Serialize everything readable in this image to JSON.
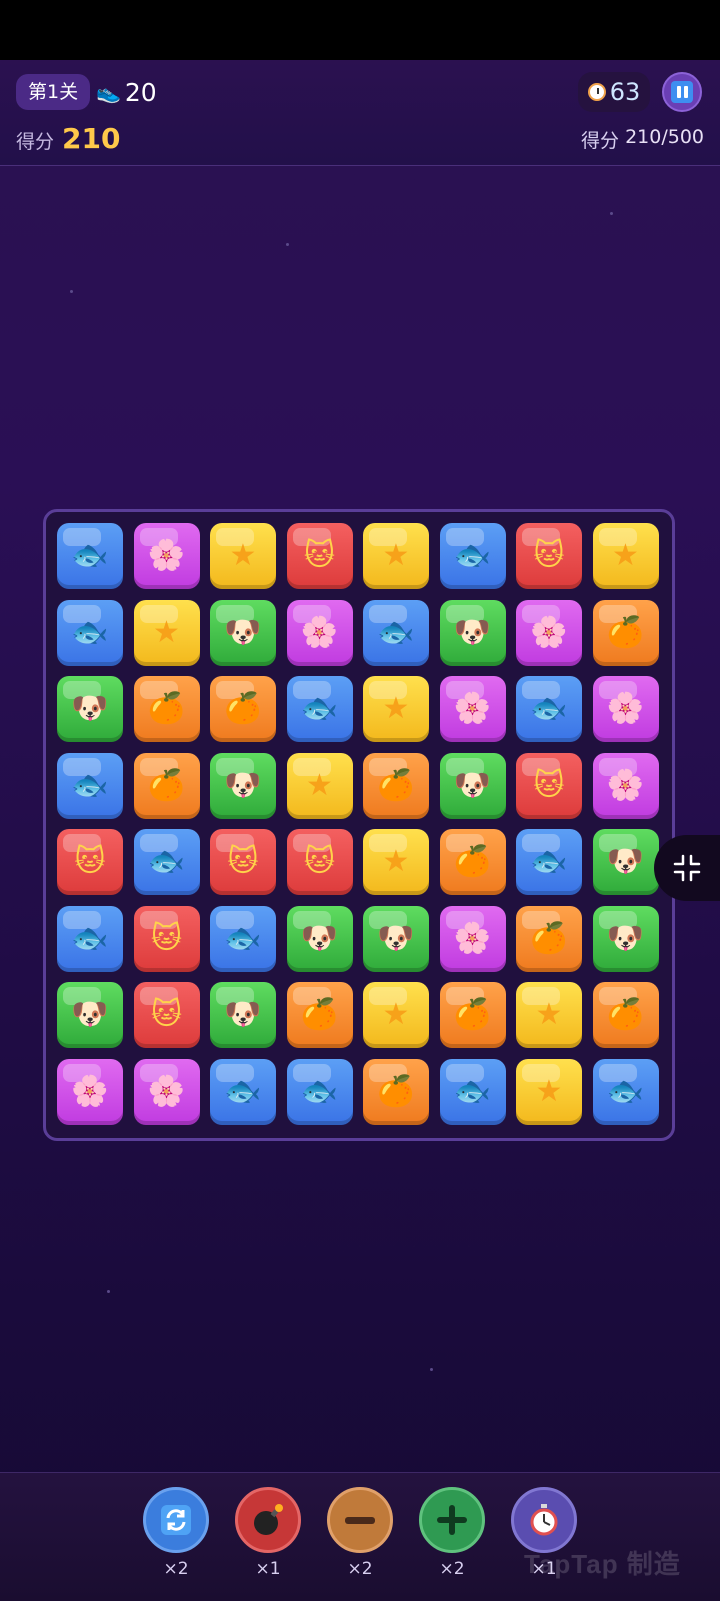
{
  "header": {
    "level_label": "第1关",
    "moves_icon": "sneaker-icon",
    "moves_value": "20",
    "timer_icon": "stopwatch-icon",
    "timer_value": "63",
    "pause_icon": "pause-icon",
    "score_label": "得分",
    "score_value": "210",
    "target_label": "得分",
    "target_value": "210/500"
  },
  "board": {
    "rows": 8,
    "cols": 8,
    "tiles": [
      [
        "fish",
        "flower",
        "star",
        "cat",
        "star",
        "fish",
        "cat",
        "star"
      ],
      [
        "fish",
        "star",
        "dog",
        "flower",
        "fish",
        "dog",
        "flower",
        "orange"
      ],
      [
        "dog",
        "orange",
        "orange",
        "fish",
        "star",
        "flower",
        "fish",
        "flower"
      ],
      [
        "fish",
        "orange",
        "dog",
        "star",
        "orange",
        "dog",
        "cat",
        "flower"
      ],
      [
        "cat",
        "fish",
        "cat",
        "cat",
        "star",
        "orange",
        "fish",
        "dog"
      ],
      [
        "fish",
        "cat",
        "fish",
        "dog",
        "dog",
        "flower",
        "orange",
        "dog"
      ],
      [
        "dog",
        "cat",
        "dog",
        "orange",
        "star",
        "orange",
        "star",
        "orange"
      ],
      [
        "flower",
        "flower",
        "fish",
        "fish",
        "orange",
        "fish",
        "star",
        "fish"
      ]
    ],
    "tile_types": {
      "fish": {
        "color": "blue",
        "glyph": "🐟",
        "icon": "fish-icon"
      },
      "flower": {
        "color": "purple",
        "glyph": "🌸",
        "icon": "flower-icon"
      },
      "star": {
        "color": "yellow",
        "glyph": "★",
        "icon": "star-icon"
      },
      "cat": {
        "color": "red",
        "glyph": "🐱",
        "icon": "cat-icon"
      },
      "dog": {
        "color": "green",
        "glyph": "🐶",
        "icon": "dog-icon"
      },
      "orange": {
        "color": "orange",
        "glyph": "🍊",
        "icon": "orange-icon"
      }
    }
  },
  "side_button": {
    "icon": "exit-fullscreen-icon"
  },
  "tools": [
    {
      "icon": "refresh-icon",
      "count": "×2"
    },
    {
      "icon": "bomb-icon",
      "count": "×1"
    },
    {
      "icon": "minus-icon",
      "count": "×2"
    },
    {
      "icon": "plus-icon",
      "count": "×2"
    },
    {
      "icon": "stopwatch-icon",
      "count": "×1"
    }
  ],
  "watermark": "TapTap 制造"
}
